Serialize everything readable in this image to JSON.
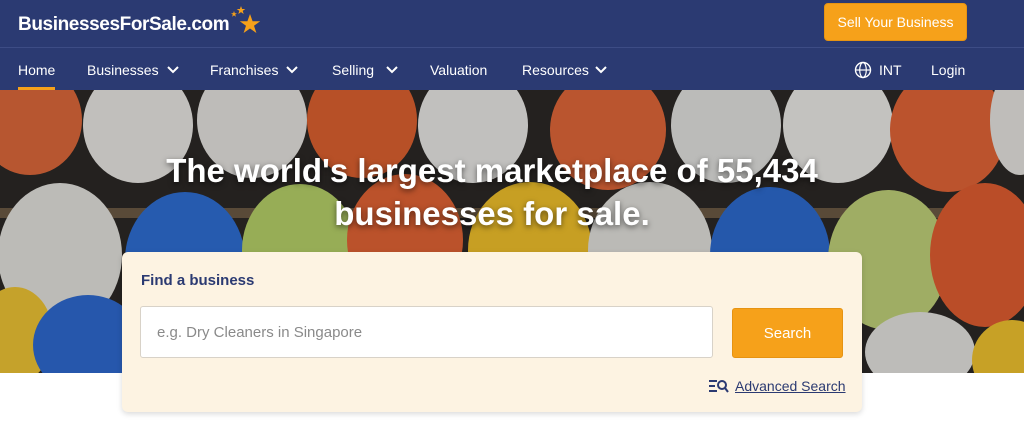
{
  "header": {
    "logo_text": "BusinessesForSale.com",
    "sell_button": "Sell Your Business",
    "brand_color": "#2b3a72",
    "accent_color": "#f6a11a"
  },
  "nav": {
    "home": "Home",
    "businesses": "Businesses",
    "franchises": "Franchises",
    "selling": "Selling",
    "valuation": "Valuation",
    "resources": "Resources",
    "region": "INT",
    "login": "Login",
    "active": "Home"
  },
  "hero": {
    "headline_line1": "The world's largest marketplace of 55,434",
    "headline_line2": "businesses for sale."
  },
  "search": {
    "label": "Find a business",
    "placeholder": "e.g. Dry Cleaners in Singapore",
    "value": "",
    "button": "Search",
    "advanced_link": "Advanced Search"
  },
  "icons": {
    "logo": "star-icon",
    "dropdown": "chevron-down-icon",
    "region": "globe-icon",
    "advanced": "search-filter-icon"
  }
}
